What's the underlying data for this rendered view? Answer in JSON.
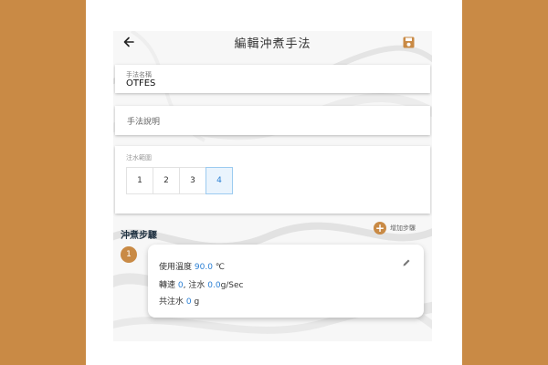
{
  "header": {
    "title": "編輯沖煮手法",
    "back_icon": "arrow-left-icon",
    "save_icon": "floppy-disk-icon"
  },
  "form": {
    "name": {
      "label": "手法名稱",
      "value": "OTFES"
    },
    "description": {
      "placeholder": "手法說明"
    },
    "pour_range": {
      "label": "注水範圍",
      "options": [
        "1",
        "2",
        "3",
        "4"
      ],
      "selected": "4"
    }
  },
  "steps_section": {
    "title": "沖煮步驟",
    "add_label": "增加步驟",
    "add_icon": "plus-icon",
    "steps": [
      {
        "index": "1",
        "temp_label": "使用溫度",
        "temp_value": "90.0",
        "temp_unit": "℃",
        "speed_label": "轉速",
        "speed_value": "0",
        "pour_label": ", 注水",
        "pour_value": "0.0",
        "pour_unit": "g/Sec",
        "total_label": "共注水",
        "total_value": "0",
        "total_unit": "g",
        "edit_icon": "pencil-icon"
      }
    ]
  },
  "colors": {
    "accent": "#c98a45",
    "value_blue": "#2a7fd4",
    "selected_bg": "#eaf4fd"
  }
}
